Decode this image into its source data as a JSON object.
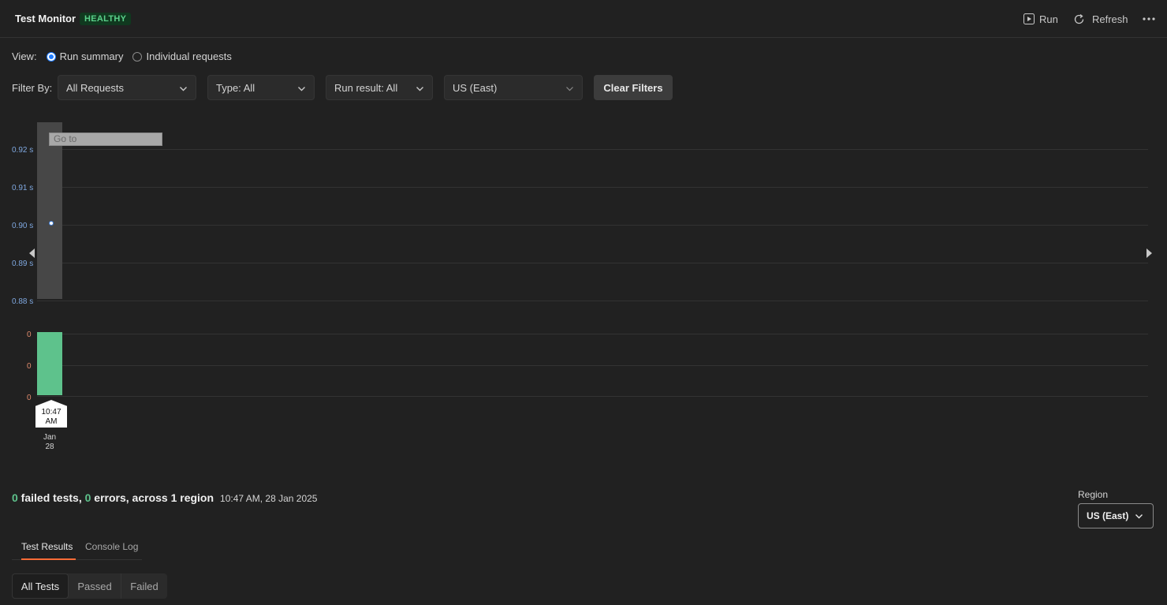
{
  "header": {
    "title": "Test Monitor",
    "status": "HEALTHY",
    "run_label": "Run",
    "refresh_label": "Refresh"
  },
  "view": {
    "label": "View:",
    "options": [
      "Run summary",
      "Individual requests"
    ],
    "selected": "Run summary"
  },
  "filters": {
    "label": "Filter By:",
    "requests": "All Requests",
    "type": "Type: All",
    "run_result": "Run result: All",
    "region": "US (East)",
    "clear_label": "Clear Filters"
  },
  "chart": {
    "goto_placeholder": "Go to",
    "response_ticks": [
      "0.92 s",
      "0.91 s",
      "0.90 s",
      "0.89 s",
      "0.88 s"
    ],
    "count_ticks": [
      "0",
      "0",
      "0"
    ],
    "time_label_line1": "10:47",
    "time_label_line2": "AM",
    "date_line1": "Jan",
    "date_line2": "28",
    "colors": {
      "response_point": "#ffffff",
      "run_bar": "#5ec28c",
      "selected_column": "#474747"
    }
  },
  "chart_data": {
    "type": "bar",
    "x": [
      "10:47 AM, Jan 28"
    ],
    "series": [
      {
        "values": [
          0.9
        ]
      },
      {
        "values": [
          0
        ]
      }
    ],
    "ylim": [
      0.88,
      0.92
    ]
  },
  "summary": {
    "failed_count": "0",
    "failed_text": " failed tests, ",
    "error_count": "0",
    "error_text": " errors, across 1 region",
    "timestamp": "10:47 AM, 28 Jan 2025"
  },
  "region": {
    "label": "Region",
    "value": "US (East)"
  },
  "tabs": [
    "Test Results",
    "Console Log"
  ],
  "result_filters": [
    "All Tests",
    "Passed",
    "Failed"
  ]
}
